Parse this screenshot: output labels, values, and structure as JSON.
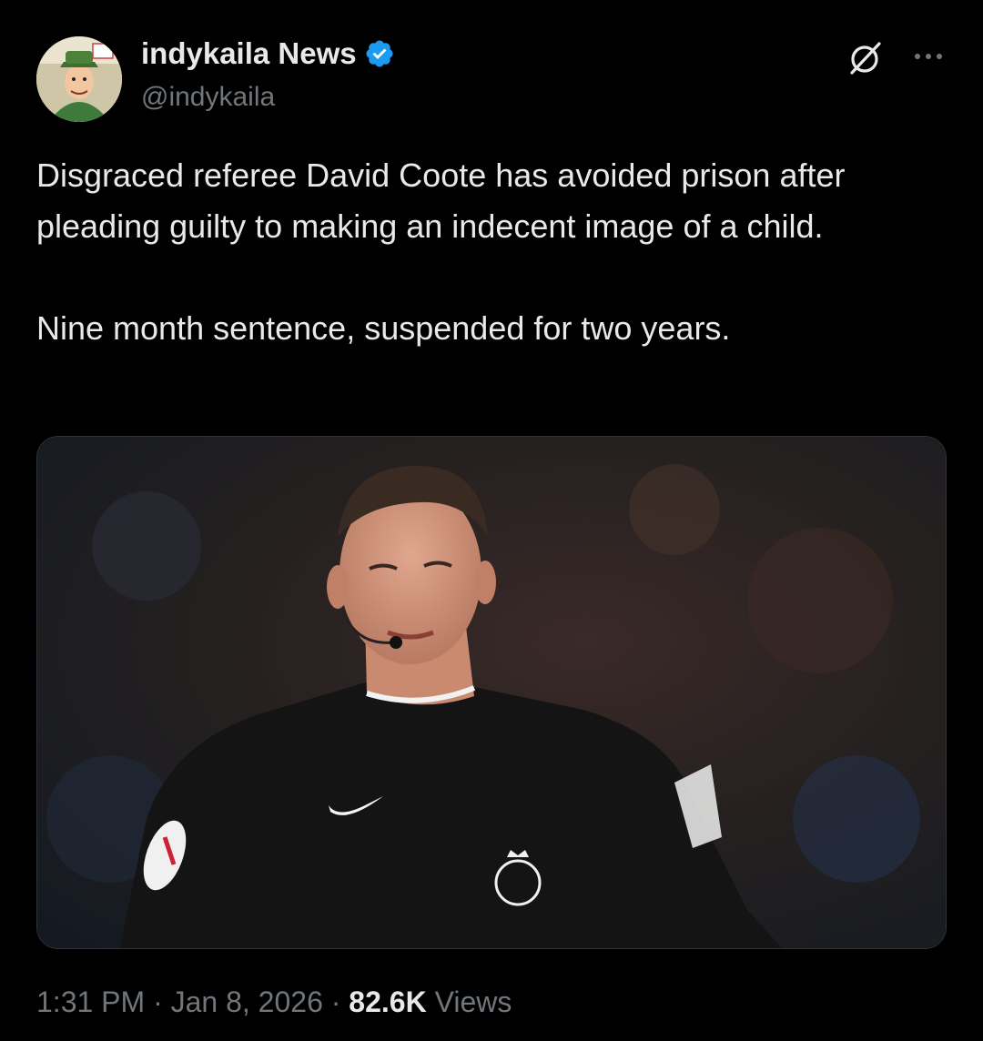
{
  "author": {
    "display_name": "indykaila News",
    "handle": "@indykaila",
    "verified": true,
    "verified_color": "#1d9bf0"
  },
  "tweet": {
    "paragraphs": [
      "Disgraced referee David Coote has avoided prison after pleading guilty to making an indecent image of a child.",
      "Nine month sentence, suspended for two years."
    ]
  },
  "meta": {
    "time": "1:31 PM",
    "separator": "·",
    "date": "Jan 8, 2026",
    "views_count": "82.6K",
    "views_label": "Views"
  },
  "icons": {
    "avatar": "avatar-illustration",
    "verified": "verified-badge-icon",
    "grok": "grok-icon",
    "more": "more-options-icon"
  },
  "colors": {
    "background": "#000000",
    "text_primary": "#e7e9ea",
    "text_secondary": "#71767b"
  }
}
